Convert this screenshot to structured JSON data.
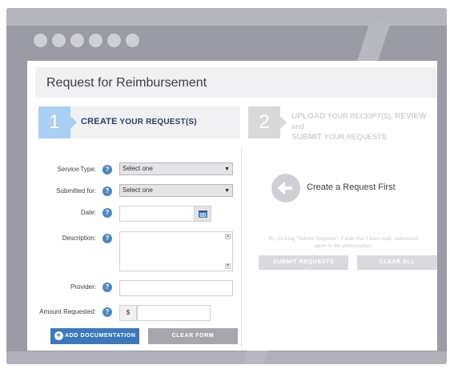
{
  "page": {
    "title": "Request for Reimbursement"
  },
  "steps": [
    {
      "number": "1",
      "label_big": "CREATE",
      "label_rest": " YOUR REQUEST(S)"
    },
    {
      "number": "2",
      "line1_big": "UPLOAD",
      "line1_mid": " YOUR RECEIPT(S), ",
      "line1_end": "REVIEW",
      "line1_tail": " and",
      "line2_big": "SUBMIT",
      "line2_rest": " YOUR REQUESTS"
    }
  ],
  "form": {
    "service_type_label": "Service Type:",
    "service_type_value": "Select one",
    "submitted_for_label": "Submitted for:",
    "submitted_for_value": "Select one",
    "date_label": "Date:",
    "date_value": "",
    "description_label": "Description:",
    "description_value": "",
    "provider_label": "Provider:",
    "provider_value": "",
    "amount_label": "Amount Requested:",
    "currency_symbol": "$",
    "amount_value": "",
    "help_glyph": "?",
    "add_documentation_label": "ADD DOCUMENTATION",
    "clear_form_label": "CLEAR FORM"
  },
  "right_panel": {
    "create_first_text": "Create a Request First",
    "disclaimer_line1": "By clicking \"Submit Requests\", I state that I have read, understand",
    "disclaimer_line2": "agree to the authorization.",
    "submit_label": "SUBMIT REQUESTS",
    "clear_all_label": "CLEAR ALL"
  },
  "icons": {
    "help": "help-icon",
    "calendar": "calendar-icon",
    "add": "plus-circle-icon",
    "back_arrow": "arrow-left-icon"
  },
  "colors": {
    "accent_blue": "#3d79b9",
    "step_active": "#a9cff2",
    "step_inactive": "#d9d9dc",
    "frame": "#9a9ba4"
  }
}
